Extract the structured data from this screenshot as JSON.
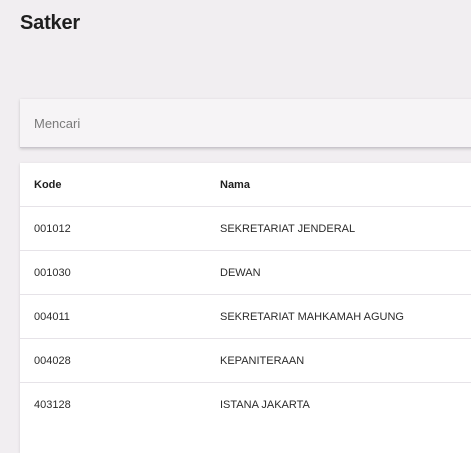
{
  "page": {
    "title": "Satker"
  },
  "search": {
    "placeholder": "Mencari",
    "value": ""
  },
  "table": {
    "headers": {
      "kode": "Kode",
      "nama": "Nama"
    },
    "rows": [
      {
        "kode": "001012",
        "nama": "SEKRETARIAT JENDERAL"
      },
      {
        "kode": "001030",
        "nama": "DEWAN"
      },
      {
        "kode": "004011",
        "nama": "SEKRETARIAT MAHKAMAH AGUNG"
      },
      {
        "kode": "004028",
        "nama": "KEPANITERAAN"
      },
      {
        "kode": "403128",
        "nama": "ISTANA JAKARTA"
      }
    ]
  }
}
